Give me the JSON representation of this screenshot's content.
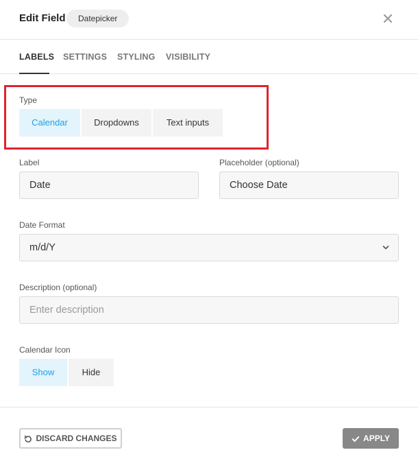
{
  "header": {
    "title": "Edit Field",
    "field_type": "Datepicker",
    "close_icon": "close-icon"
  },
  "tabs": [
    {
      "label": "LABELS",
      "active": true
    },
    {
      "label": "SETTINGS",
      "active": false
    },
    {
      "label": "STYLING",
      "active": false
    },
    {
      "label": "VISIBILITY",
      "active": false
    }
  ],
  "type": {
    "label": "Type",
    "options": [
      "Calendar",
      "Dropdowns",
      "Text inputs"
    ],
    "selected": "Calendar"
  },
  "label_field": {
    "label": "Label",
    "value": "Date"
  },
  "placeholder_field": {
    "label": "Placeholder (optional)",
    "value": "Choose Date"
  },
  "date_format": {
    "label": "Date Format",
    "value": "m/d/Y"
  },
  "description": {
    "label": "Description (optional)",
    "placeholder": "Enter description"
  },
  "calendar_icon": {
    "label": "Calendar Icon",
    "options": [
      "Show",
      "Hide"
    ],
    "selected": "Show"
  },
  "footer": {
    "discard_label": "DISCARD CHANGES",
    "apply_label": "APPLY"
  },
  "colors": {
    "accent": "#1ea2e0",
    "active_bg": "#e3f4fd",
    "highlight_border": "#e0232c",
    "apply_bg": "#888888"
  }
}
